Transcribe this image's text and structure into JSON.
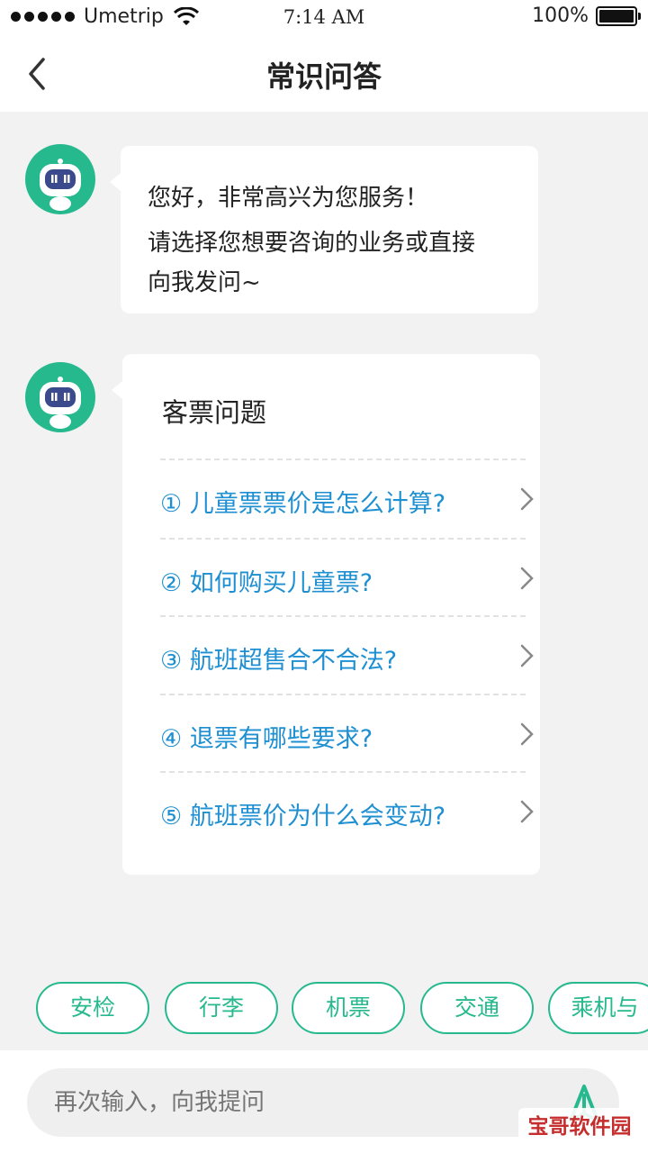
{
  "status_bar": {
    "carrier": "Umetrip",
    "time": "7:14 AM",
    "battery": "100%"
  },
  "nav": {
    "title": "常识问答",
    "back_icon": "chevron-left-icon"
  },
  "messages": {
    "greeting_line1": "您好，非常高兴为您服务！",
    "greeting_line2": "请选择您想要咨询的业务或直接",
    "greeting_line3": "向我发问~"
  },
  "faq": {
    "section_title": "客票问题",
    "questions": [
      "① 儿童票票价是怎么计算?",
      "② 如何购买儿童票?",
      "③ 航班超售合不合法?",
      "④  退票有哪些要求?",
      "⑤  航班票价为什么会变动?"
    ]
  },
  "chips": [
    "安检",
    "行李",
    "机票",
    "交通",
    "乘机与"
  ],
  "input": {
    "placeholder": "再次输入，向我提问"
  },
  "watermark": "宝哥软件园",
  "colors": {
    "accent_green": "#27b98e",
    "link_blue": "#1e8fd1"
  }
}
